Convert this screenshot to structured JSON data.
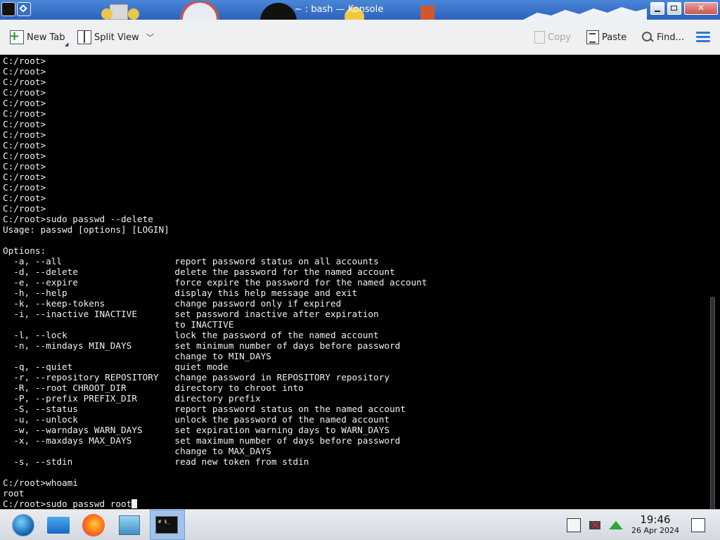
{
  "window": {
    "title": "~ : bash — Konsole"
  },
  "toolbar": {
    "new_tab": "New Tab",
    "split_view": "Split View",
    "copy": "Copy",
    "paste": "Paste",
    "find": "Find..."
  },
  "icons": {
    "app": "konsole-app-icon",
    "window_menu": "window-menu-icon",
    "new_tab": "new-tab-icon",
    "split_view": "split-view-icon",
    "copy": "copy-icon",
    "paste": "paste-icon",
    "find": "search-icon",
    "hamburger": "hamburger-menu-icon"
  },
  "terminal": {
    "lines": [
      "C:/root>",
      "C:/root>",
      "C:/root>",
      "C:/root>",
      "C:/root>",
      "C:/root>",
      "C:/root>",
      "C:/root>",
      "C:/root>",
      "C:/root>",
      "C:/root>",
      "C:/root>",
      "C:/root>",
      "C:/root>",
      "C:/root>",
      "C:/root>sudo passwd --delete",
      "Usage: passwd [options] [LOGIN]",
      "",
      "Options:",
      "  -a, --all                     report password status on all accounts",
      "  -d, --delete                  delete the password for the named account",
      "  -e, --expire                  force expire the password for the named account",
      "  -h, --help                    display this help message and exit",
      "  -k, --keep-tokens             change password only if expired",
      "  -i, --inactive INACTIVE       set password inactive after expiration",
      "                                to INACTIVE",
      "  -l, --lock                    lock the password of the named account",
      "  -n, --mindays MIN_DAYS        set minimum number of days before password",
      "                                change to MIN_DAYS",
      "  -q, --quiet                   quiet mode",
      "  -r, --repository REPOSITORY   change password in REPOSITORY repository",
      "  -R, --root CHROOT_DIR         directory to chroot into",
      "  -P, --prefix PREFIX_DIR       directory prefix",
      "  -S, --status                  report password status on the named account",
      "  -u, --unlock                  unlock the password of the named account",
      "  -w, --warndays WARN_DAYS      set expiration warning days to WARN_DAYS",
      "  -x, --maxdays MAX_DAYS        set maximum number of days before password",
      "                                change to MAX_DAYS",
      "  -s, --stdin                   read new token from stdin",
      "",
      "C:/root>whoami",
      "root"
    ],
    "current_input": "C:/root>sudo passwd root"
  },
  "taskbar": {
    "konsole_label": "#  $_",
    "clock_time": "19:46",
    "clock_date": "26 Apr 2024",
    "icons": [
      "start-menu-icon",
      "file-manager-icon",
      "firefox-icon",
      "network-manager-icon",
      "konsole-icon"
    ],
    "tray": [
      "clipboard-icon",
      "network-disconnected-icon",
      "update-notifier-icon",
      "show-desktop-icon"
    ]
  },
  "colors": {
    "titlebar": "#2b62bb",
    "toolbar_bg": "#eff0f1",
    "terminal_bg": "#000000",
    "terminal_fg": "#f0f0f0",
    "accent": "#2a7bd0"
  }
}
